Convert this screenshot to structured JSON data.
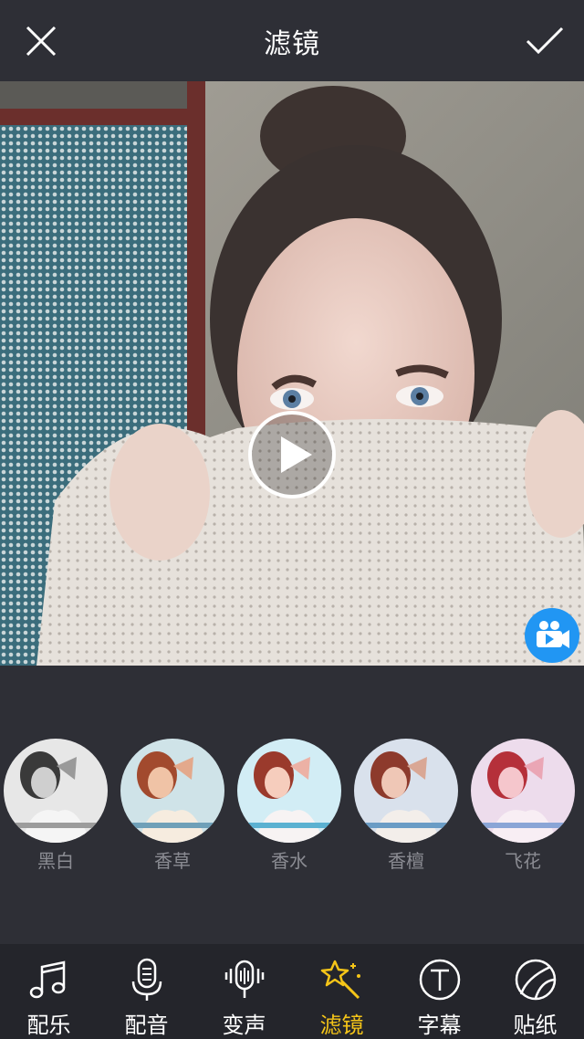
{
  "header": {
    "title": "滤镜",
    "close_icon": "close-icon",
    "confirm_icon": "checkmark-icon"
  },
  "preview": {
    "play_icon": "play-icon",
    "video_icon": "video-camera-icon"
  },
  "filters": [
    {
      "label": "黑白"
    },
    {
      "label": "香草"
    },
    {
      "label": "香水"
    },
    {
      "label": "香檀"
    },
    {
      "label": "飞花"
    }
  ],
  "tabs": [
    {
      "label": "配乐",
      "icon": "music-note-icon"
    },
    {
      "label": "配音",
      "icon": "microphone-icon"
    },
    {
      "label": "变声",
      "icon": "voice-change-icon"
    },
    {
      "label": "滤镜",
      "icon": "magic-wand-icon",
      "active": true
    },
    {
      "label": "字幕",
      "icon": "text-icon"
    },
    {
      "label": "贴纸",
      "icon": "sticker-icon"
    }
  ],
  "colors": {
    "background": "#2e2f36",
    "bottom_bar": "#24252b",
    "active_tab": "#f5c518",
    "filter_label": "#8b8c93",
    "video_button": "#2196f3"
  }
}
